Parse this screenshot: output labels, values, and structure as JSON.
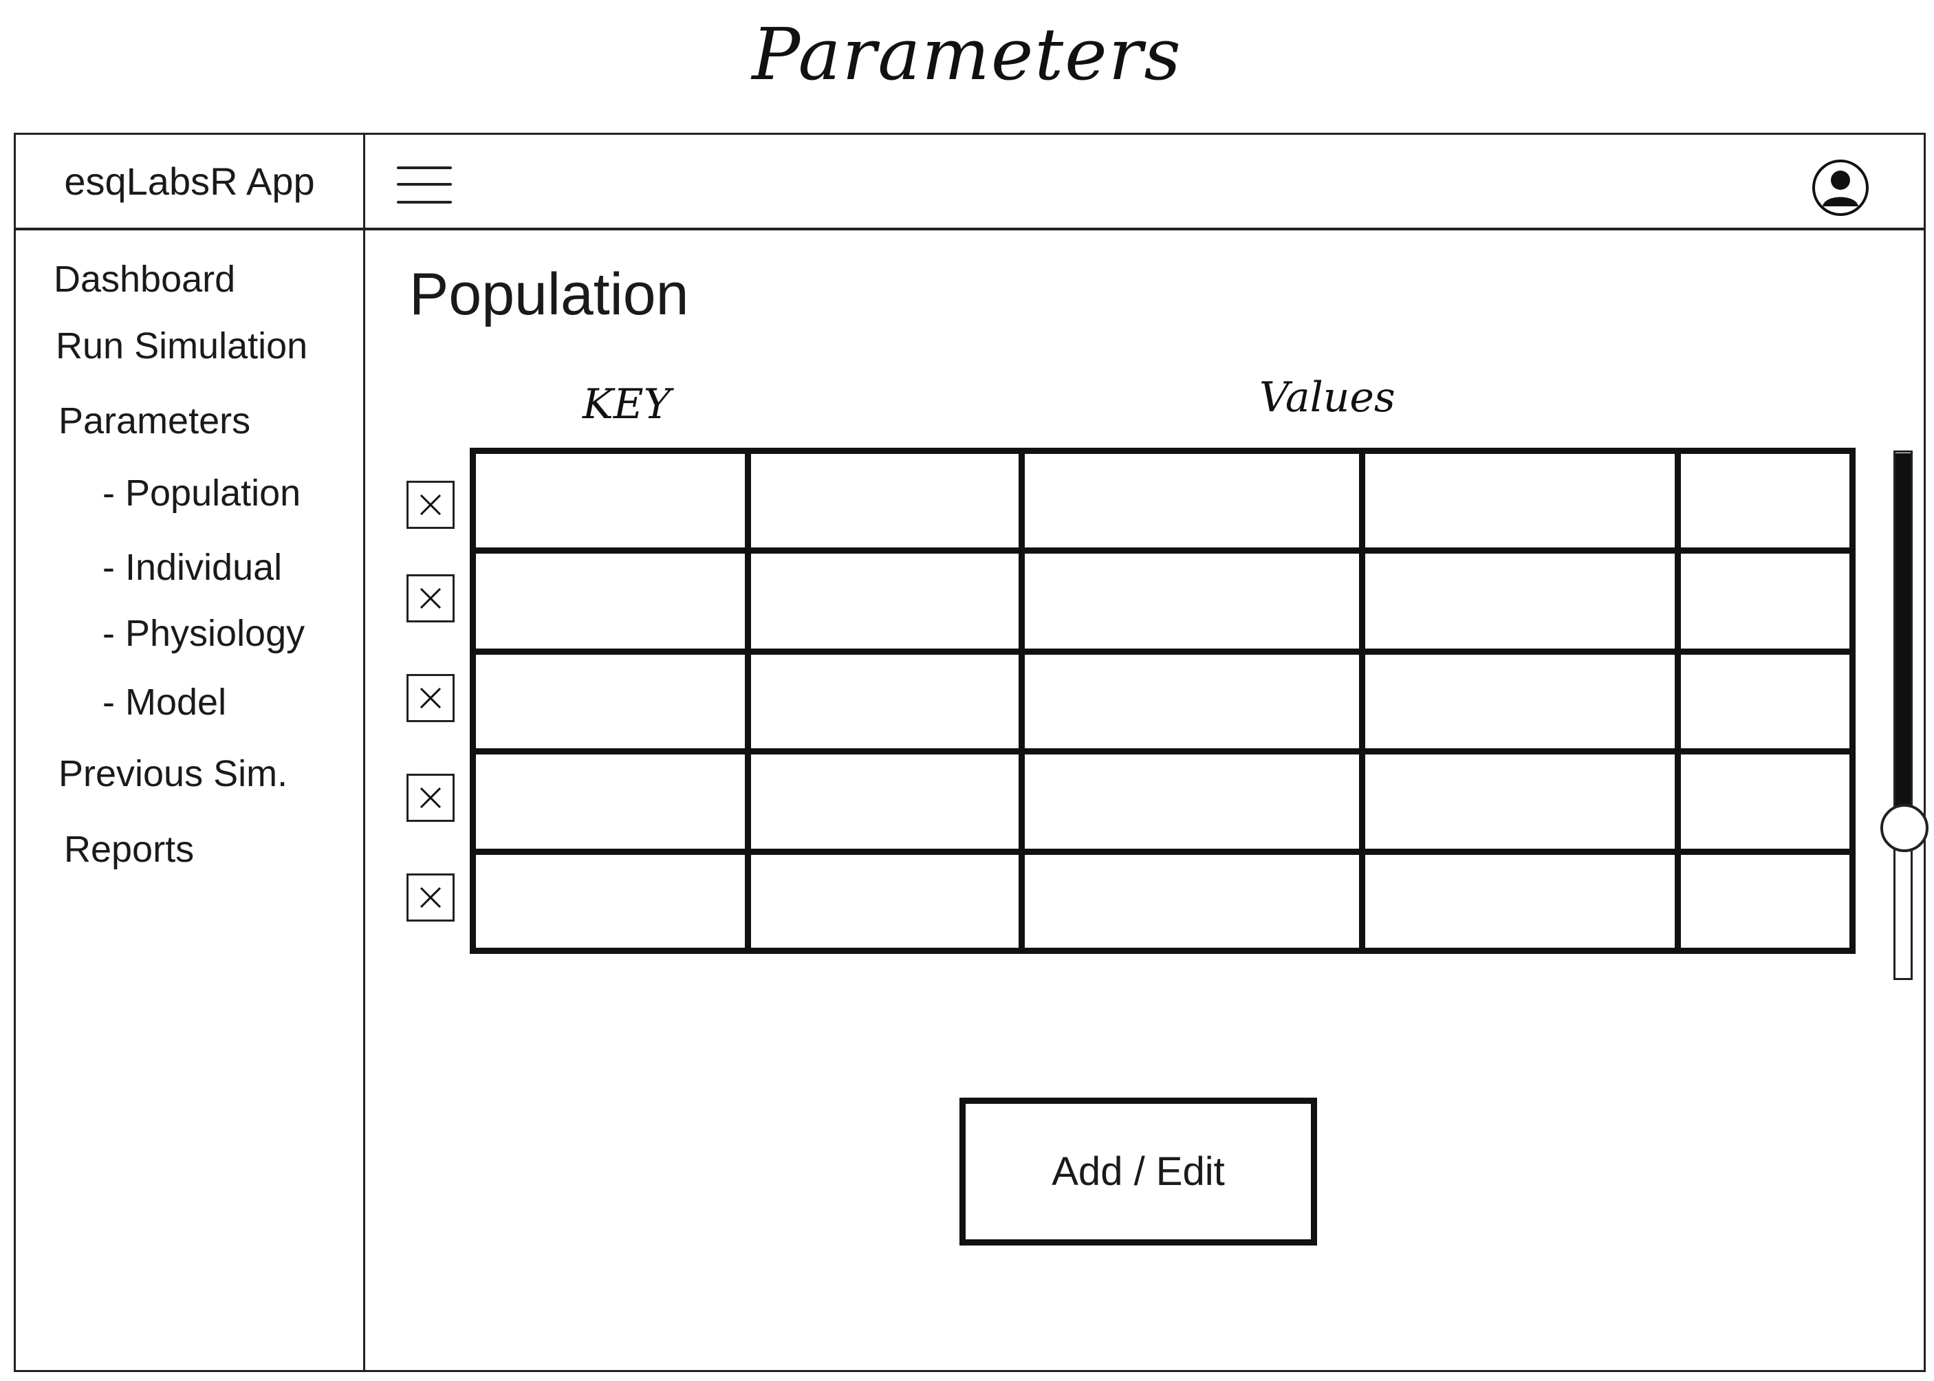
{
  "sketch_title": "Parameters",
  "app": {
    "title": "esqLabsR App"
  },
  "header": {
    "menu_icon": "hamburger-menu-icon",
    "user_icon": "user-account-icon"
  },
  "sidebar": {
    "items": [
      {
        "label": "Dashboard"
      },
      {
        "label": "Run Simulation"
      },
      {
        "label": "Parameters"
      },
      {
        "label": "- Population"
      },
      {
        "label": "- Individual"
      },
      {
        "label": "- Physiology"
      },
      {
        "label": "- Model"
      },
      {
        "label": "Previous Sim."
      },
      {
        "label": "Reports"
      }
    ]
  },
  "main": {
    "heading": "Population",
    "table": {
      "key_header": "KEY",
      "values_header": "Values",
      "rows": [
        [
          "",
          "",
          "",
          "",
          ""
        ],
        [
          "",
          "",
          "",
          "",
          ""
        ],
        [
          "",
          "",
          "",
          "",
          ""
        ],
        [
          "",
          "",
          "",
          "",
          ""
        ],
        [
          "",
          "",
          "",
          "",
          ""
        ]
      ]
    },
    "row_delete_icon": "close-x-icon",
    "add_edit_label": "Add / Edit"
  },
  "colors": {
    "ink": "#111111",
    "background": "#ffffff"
  }
}
